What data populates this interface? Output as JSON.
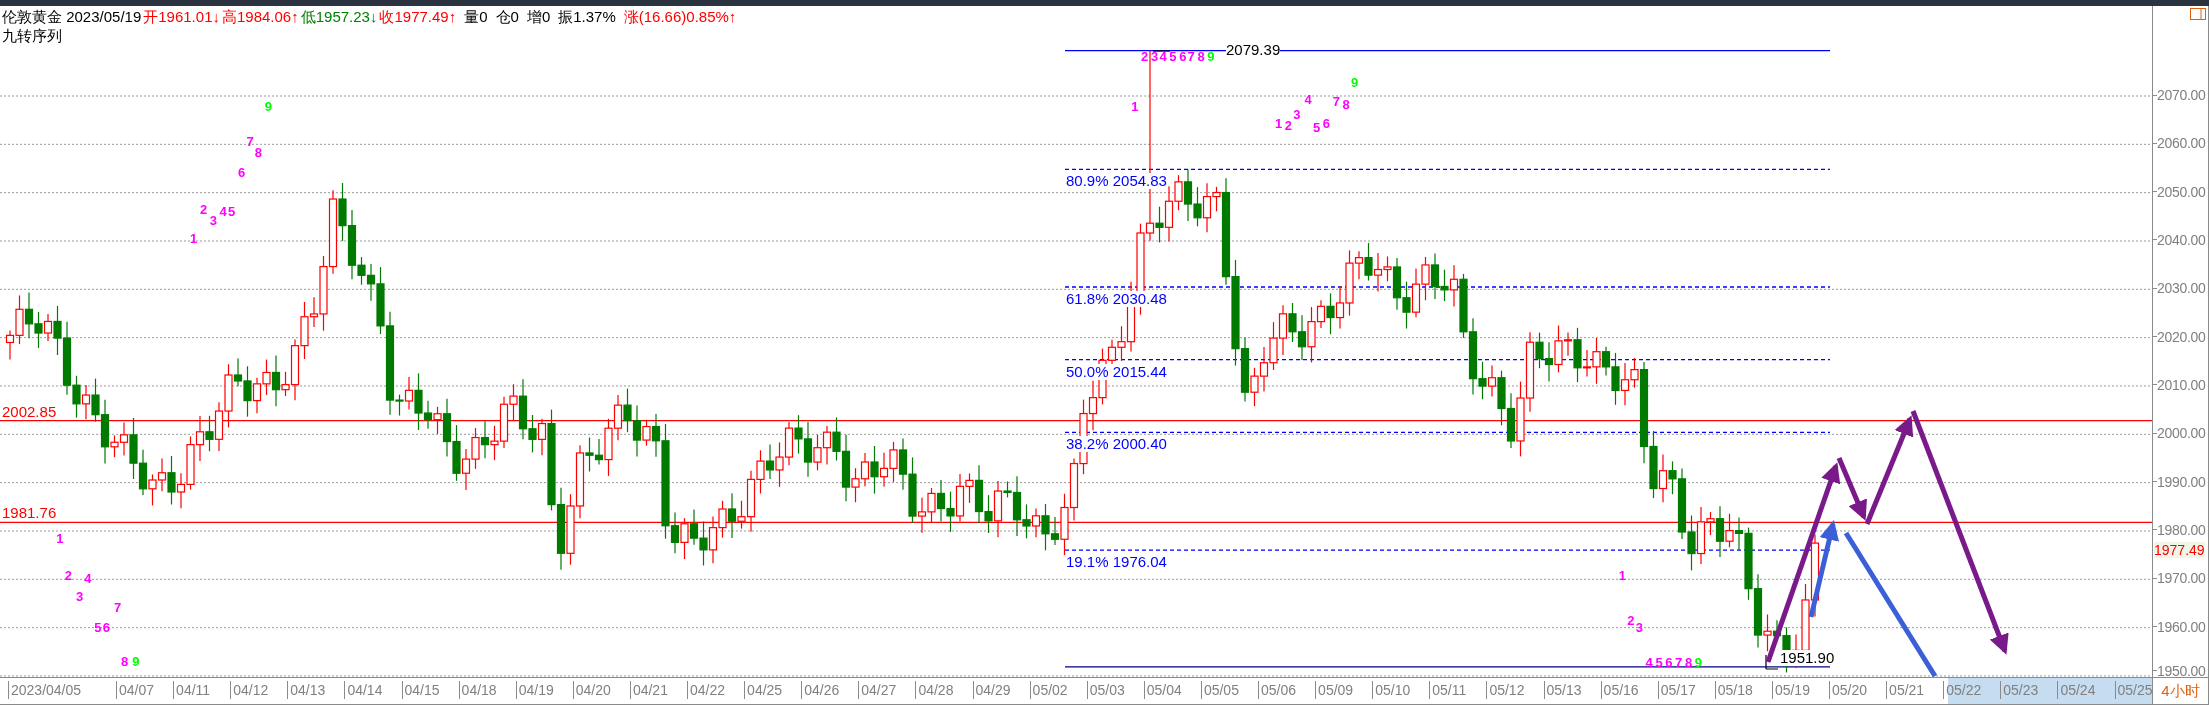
{
  "header": {
    "items": [
      {
        "text": "伦敦黄金 2023/05/19",
        "color": "#000000"
      },
      {
        "text": "开1961.01↓",
        "color": "#ff0000"
      },
      {
        "text": "高1984.06↑",
        "color": "#ff0000"
      },
      {
        "text": "低1957.23↓",
        "color": "#008000"
      },
      {
        "text": "收1977.49↑",
        "color": "#ff0000"
      },
      {
        "text": "量0",
        "color": "#000000"
      },
      {
        "text": "仓0",
        "color": "#000000"
      },
      {
        "text": "增0",
        "color": "#000000"
      },
      {
        "text": "振1.37%",
        "color": "#000000"
      },
      {
        "text": "涨(16.66)0.85%↑",
        "color": "#ff0000"
      }
    ],
    "indicator": "九转序列"
  },
  "price_lines": [
    {
      "label": "2002.85"
    },
    {
      "label": "1981.76"
    }
  ],
  "extremes": {
    "high": "2079.39",
    "low": "1951.90"
  },
  "fib_levels": [
    {
      "label": "80.9% 2054.83"
    },
    {
      "label": "61.8% 2030.48"
    },
    {
      "label": "50.0% 2015.44"
    },
    {
      "label": "38.2% 2000.40"
    },
    {
      "label": "19.1% 1976.04"
    }
  ],
  "sequence_marks": [
    {
      "text": "1",
      "color": "#ff00ff"
    },
    {
      "text": "2",
      "color": "#ff00ff"
    },
    {
      "text": "4",
      "color": "#ff00ff"
    },
    {
      "text": "3",
      "color": "#ff00ff"
    },
    {
      "text": "7",
      "color": "#ff00ff"
    },
    {
      "text": "5",
      "color": "#ff00ff"
    },
    {
      "text": "6",
      "color": "#ff00ff"
    },
    {
      "text": "8",
      "color": "#ff00ff"
    },
    {
      "text": "9",
      "color": "#00ff00"
    },
    {
      "text": "1",
      "color": "#ff00ff"
    },
    {
      "text": "2",
      "color": "#ff00ff"
    },
    {
      "text": "3",
      "color": "#ff00ff"
    },
    {
      "text": "4",
      "color": "#ff00ff"
    },
    {
      "text": "5",
      "color": "#ff00ff"
    },
    {
      "text": "6",
      "color": "#ff00ff"
    },
    {
      "text": "7",
      "color": "#ff00ff"
    },
    {
      "text": "8",
      "color": "#ff00ff"
    },
    {
      "text": "9",
      "color": "#00ff00"
    },
    {
      "text": "1",
      "color": "#ff00ff"
    },
    {
      "text": "2",
      "color": "#ff00ff"
    },
    {
      "text": "3",
      "color": "#ff00ff"
    },
    {
      "text": "4",
      "color": "#ff00ff"
    },
    {
      "text": "5",
      "color": "#ff00ff"
    },
    {
      "text": "6",
      "color": "#ff00ff"
    },
    {
      "text": "7",
      "color": "#ff00ff"
    },
    {
      "text": "8",
      "color": "#ff00ff"
    },
    {
      "text": "9",
      "color": "#00ff00"
    },
    {
      "text": "1",
      "color": "#ff00ff"
    },
    {
      "text": "2",
      "color": "#ff00ff"
    },
    {
      "text": "3",
      "color": "#ff00ff"
    },
    {
      "text": "4",
      "color": "#ff00ff"
    },
    {
      "text": "5",
      "color": "#ff00ff"
    },
    {
      "text": "6",
      "color": "#ff00ff"
    },
    {
      "text": "7",
      "color": "#ff00ff"
    },
    {
      "text": "8",
      "color": "#ff00ff"
    },
    {
      "text": "9",
      "color": "#00ff00"
    },
    {
      "text": "1",
      "color": "#ff00ff"
    },
    {
      "text": "2",
      "color": "#ff00ff"
    },
    {
      "text": "3",
      "color": "#ff00ff"
    },
    {
      "text": "4",
      "color": "#ff00ff"
    },
    {
      "text": "5",
      "color": "#ff00ff"
    },
    {
      "text": "6",
      "color": "#ff00ff"
    },
    {
      "text": "7",
      "color": "#ff00ff"
    },
    {
      "text": "8",
      "color": "#ff00ff"
    },
    {
      "text": "9",
      "color": "#00ff00"
    }
  ],
  "y_axis": {
    "ticks": [
      "2070.00",
      "2060.00",
      "2050.00",
      "2040.00",
      "2030.00",
      "2020.00",
      "2010.00",
      "2000.00",
      "1990.00",
      "1980.00",
      "1970.00",
      "1960.00",
      "1950.00"
    ],
    "current": "1977.49"
  },
  "x_axis": {
    "dates": [
      "2023/04/05",
      "04/07",
      "04/11",
      "04/12",
      "04/13",
      "04/14",
      "04/15",
      "04/18",
      "04/19",
      "04/20",
      "04/21",
      "04/22",
      "04/25",
      "04/26",
      "04/27",
      "04/28",
      "04/29",
      "05/02",
      "05/03",
      "05/04",
      "05/05",
      "05/06",
      "05/09",
      "05/10",
      "05/11",
      "05/12",
      "05/13",
      "05/16",
      "05/17",
      "05/18",
      "05/19",
      "05/20",
      "05/21",
      "05/22",
      "05/23",
      "05/24",
      "05/25"
    ],
    "period": "4小时"
  }
}
